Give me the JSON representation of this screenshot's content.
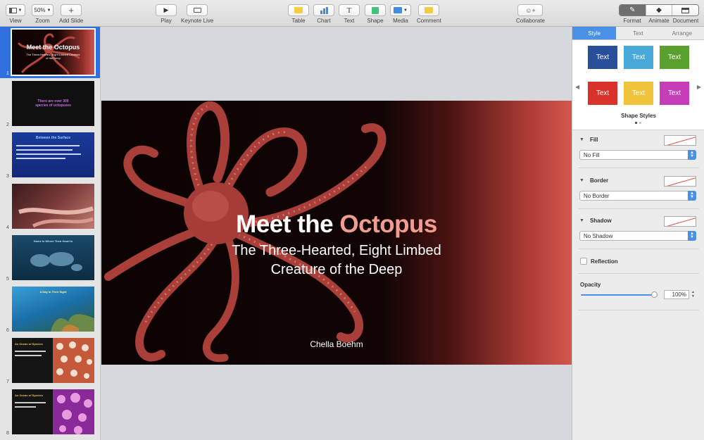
{
  "toolbar": {
    "view": {
      "label": "View",
      "icon": "view-sidebar-icon"
    },
    "zoom": {
      "label": "Zoom",
      "value": "50%"
    },
    "add_slide": {
      "label": "Add Slide",
      "icon": "plus-icon"
    },
    "play": {
      "label": "Play",
      "icon": "play-icon"
    },
    "keynote_live": {
      "label": "Keynote Live",
      "icon": "keynote-live-icon"
    },
    "table": {
      "label": "Table",
      "icon": "table-icon",
      "color": "#f6cd41"
    },
    "chart": {
      "label": "Chart",
      "icon": "chart-icon",
      "color": "#3e8de3"
    },
    "text": {
      "label": "Text",
      "icon": "text-icon",
      "glyph": "T"
    },
    "shape": {
      "label": "Shape",
      "icon": "shape-icon",
      "color": "#42c27a"
    },
    "media": {
      "label": "Media",
      "icon": "media-icon",
      "color": "#3e8de3"
    },
    "comment": {
      "label": "Comment",
      "icon": "comment-icon",
      "color": "#f4cc43"
    },
    "collaborate": {
      "label": "Collaborate",
      "icon": "collaborate-icon"
    },
    "format": {
      "label": "Format",
      "icon": "paintbrush-icon"
    },
    "animate": {
      "label": "Animate",
      "icon": "diamond-icon"
    },
    "document": {
      "label": "Document",
      "icon": "document-icon"
    }
  },
  "navigator": {
    "slides": [
      {
        "number": "1",
        "title_lines": [
          "Meet the Octopus"
        ],
        "subtitle": "The Three-Hearted, Eight Limbed Creature of the Deep",
        "selected": true
      },
      {
        "number": "2",
        "title_lines": [
          "There are over 300",
          "species of octopuses"
        ],
        "selected": false
      },
      {
        "number": "3",
        "title_lines": [
          "Between the Surface"
        ],
        "selected": false
      },
      {
        "number": "4",
        "title_lines": [
          ""
        ],
        "selected": false
      },
      {
        "number": "5",
        "title_lines": [
          "Home is Where Their Heart Is"
        ],
        "selected": false
      },
      {
        "number": "6",
        "title_lines": [
          "A Day in Their Sight"
        ],
        "selected": false
      },
      {
        "number": "7",
        "title_lines": [
          "An Ocean of Species"
        ],
        "selected": false
      },
      {
        "number": "8",
        "title_lines": [
          "An Ocean of Species"
        ],
        "selected": false
      }
    ]
  },
  "slide": {
    "title_part1": "Meet the ",
    "title_part2": "Octopus",
    "subtitle_line1": "The Three-Hearted, Eight Limbed",
    "subtitle_line2": "Creature of the Deep",
    "author": "Chella Boehm",
    "title_accent_color": "#f09d90"
  },
  "inspector": {
    "tabs": [
      {
        "label": "Style",
        "active": true
      },
      {
        "label": "Text",
        "active": false
      },
      {
        "label": "Arrange",
        "active": false
      }
    ],
    "shape_styles_label": "Shape Styles",
    "shape_styles": [
      {
        "label": "Text",
        "color": "#2a4f9a"
      },
      {
        "label": "Text",
        "color": "#48a8d8"
      },
      {
        "label": "Text",
        "color": "#5aa02e"
      },
      {
        "label": "Text",
        "color": "#d8322a"
      },
      {
        "label": "Text",
        "color": "#f1c33a"
      },
      {
        "label": "Text",
        "color": "#c63cb6"
      }
    ],
    "fill": {
      "label": "Fill",
      "value": "No Fill"
    },
    "border": {
      "label": "Border",
      "value": "No Border"
    },
    "shadow": {
      "label": "Shadow",
      "value": "No Shadow"
    },
    "reflection": {
      "label": "Reflection",
      "checked": false
    },
    "opacity": {
      "label": "Opacity",
      "value": "100%",
      "level": 1.0
    }
  }
}
